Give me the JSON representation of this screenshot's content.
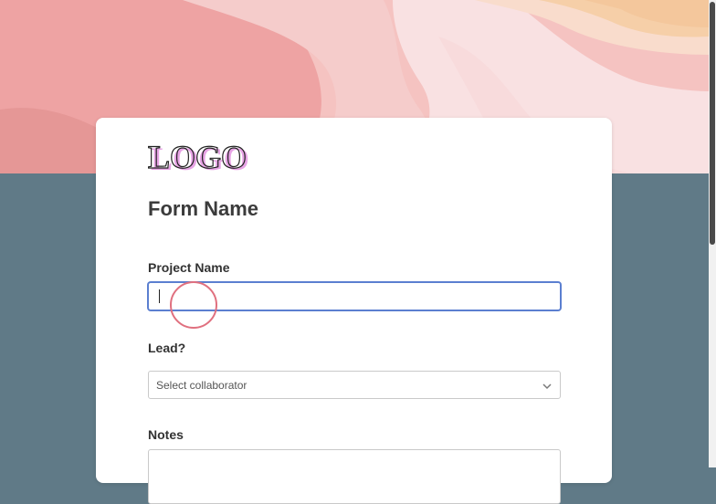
{
  "logo": {
    "text": "LOGO",
    "color": "#e7a3e5"
  },
  "form": {
    "title": "Form Name",
    "project_name": {
      "label": "Project Name",
      "value": ""
    },
    "lead": {
      "label": "Lead?",
      "selected": "Select collaborator"
    },
    "notes": {
      "label": "Notes",
      "value": ""
    }
  },
  "icons": {
    "dropdown": "chevron-down-icon"
  },
  "colors": {
    "page_background": "#607a87",
    "focus_border": "#5b7fd0",
    "click_indicator": "#e0707f"
  }
}
